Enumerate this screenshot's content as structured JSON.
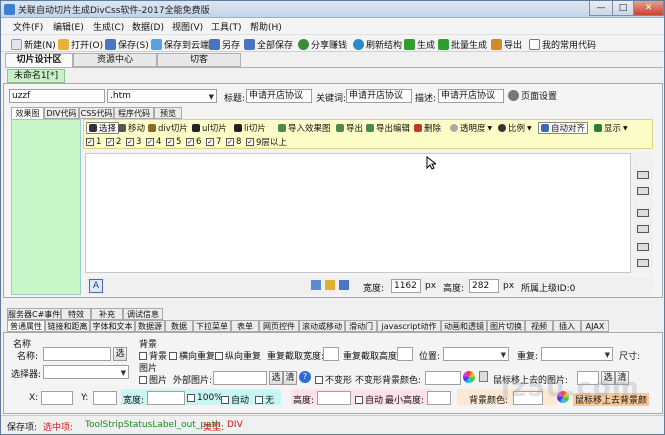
{
  "window": {
    "title": "关联自动切片生成DivCss软件-2017全能免费版",
    "min": "—",
    "max": "□",
    "close": "✕"
  },
  "menu": [
    "文件(F)",
    "编辑(E)",
    "生成(C)",
    "数据(D)",
    "视图(V)",
    "工具(T)",
    "帮助(H)"
  ],
  "toolbar": [
    {
      "label": "新建(N)",
      "color": "#dfe6ee"
    },
    {
      "label": "打开(O)",
      "color": "#e8b13c"
    },
    {
      "label": "保存(S)",
      "color": "#4a74c4"
    },
    {
      "label": "保存到云端",
      "color": "#5aa0e0"
    },
    {
      "label": "另存",
      "color": "#4a74c4"
    },
    {
      "label": "全部保存",
      "color": "#4a74c4"
    },
    {
      "label": "分享赚钱",
      "color": "#3a8a3a"
    },
    {
      "label": "刷新结构",
      "color": "#2a8ad0"
    },
    {
      "label": "生成",
      "color": "#2e9e2e"
    },
    {
      "label": "批量生成",
      "color": "#2e9e2e"
    },
    {
      "label": "导出",
      "color": "#d08a2a"
    },
    {
      "label": "我的常用代码",
      "color": "#888888"
    }
  ],
  "main_tabs": [
    "切片设计区",
    "资源中心",
    "切客"
  ],
  "doc_tab": "未命名1[*]",
  "page": {
    "name_value": "uzzf",
    "ext_value": ".htm",
    "title_label": "标题:",
    "title_value": "申请开店协议",
    "keywords_label": "关键词:",
    "keywords_value": "申请开店协议",
    "desc_label": "描述:",
    "desc_value": "申请开店协议",
    "page_settings": "页面设置"
  },
  "sub_tabs": [
    "效果图",
    "DIV代码",
    "CSS代码",
    "程序代码",
    "预览"
  ],
  "slice_toolbar": [
    "选择",
    "移动",
    "div切片",
    "ul切片",
    "li切片",
    "导入效果图",
    "导出",
    "导出编辑",
    "删除",
    "透明度",
    "比例",
    "自动对齐",
    "显示"
  ],
  "layer_checks": [
    "1",
    "2",
    "3",
    "4",
    "5",
    "6",
    "7",
    "8",
    "9层以上"
  ],
  "bottom": {
    "width_label": "宽度:",
    "width_value": "1162",
    "width_unit": "px",
    "height_label": "高度:",
    "height_value": "282",
    "height_unit": "px",
    "parent_label": "所属上级ID:",
    "parent_value": "0"
  },
  "prop_tabs_row1": [
    "服务器C#事件",
    "特效",
    "补充",
    "调试信息"
  ],
  "prop_tabs_row2": [
    "普通属性",
    "链接和距离",
    "字体和文本",
    "数据源",
    "数据",
    "下拉菜单",
    "表单",
    "网页控件",
    "滚动或移动",
    "滑动门",
    "javascript动作",
    "动画和透镜",
    "图片切换",
    "视频",
    "插入",
    "AJAX"
  ],
  "props": {
    "name_group": "名称",
    "name_label": "名称:",
    "selector_label": "选择器:",
    "bg_group": "背景",
    "bg_check": "背景",
    "repeat_x": "横向重复",
    "repeat_y": "纵向重复",
    "repeat_w": "重复截取宽度:",
    "repeat_h": "重复截取高度:",
    "position": "位置:",
    "repeat": "重复:",
    "size": "尺寸:",
    "img_group": "图片",
    "img_check": "图片",
    "ext_img": "外部图片:",
    "choose": "选",
    "clear": "清",
    "no_deform": "不变形",
    "no_deform_bg": "不变形背景颜色:",
    "hover_img": "鼠标移上去的图片:",
    "x_label": "X:",
    "y_label": "Y:",
    "width_label": "宽度:",
    "pct_label": "100%",
    "auto1": "自动",
    "none": "无",
    "height_label": "高度:",
    "auto2": "自动",
    "min_height": "最小高度:",
    "bg_color": "背景颜色:",
    "hover_bg": "鼠标移上去背景颜"
  },
  "status": {
    "label": "保存项:",
    "selected": "选中项:",
    "item": "ToolStripStatusLabel_out_path",
    "type_label": "类型:",
    "type_value": "DIV"
  },
  "watermark": "jz5u.com"
}
